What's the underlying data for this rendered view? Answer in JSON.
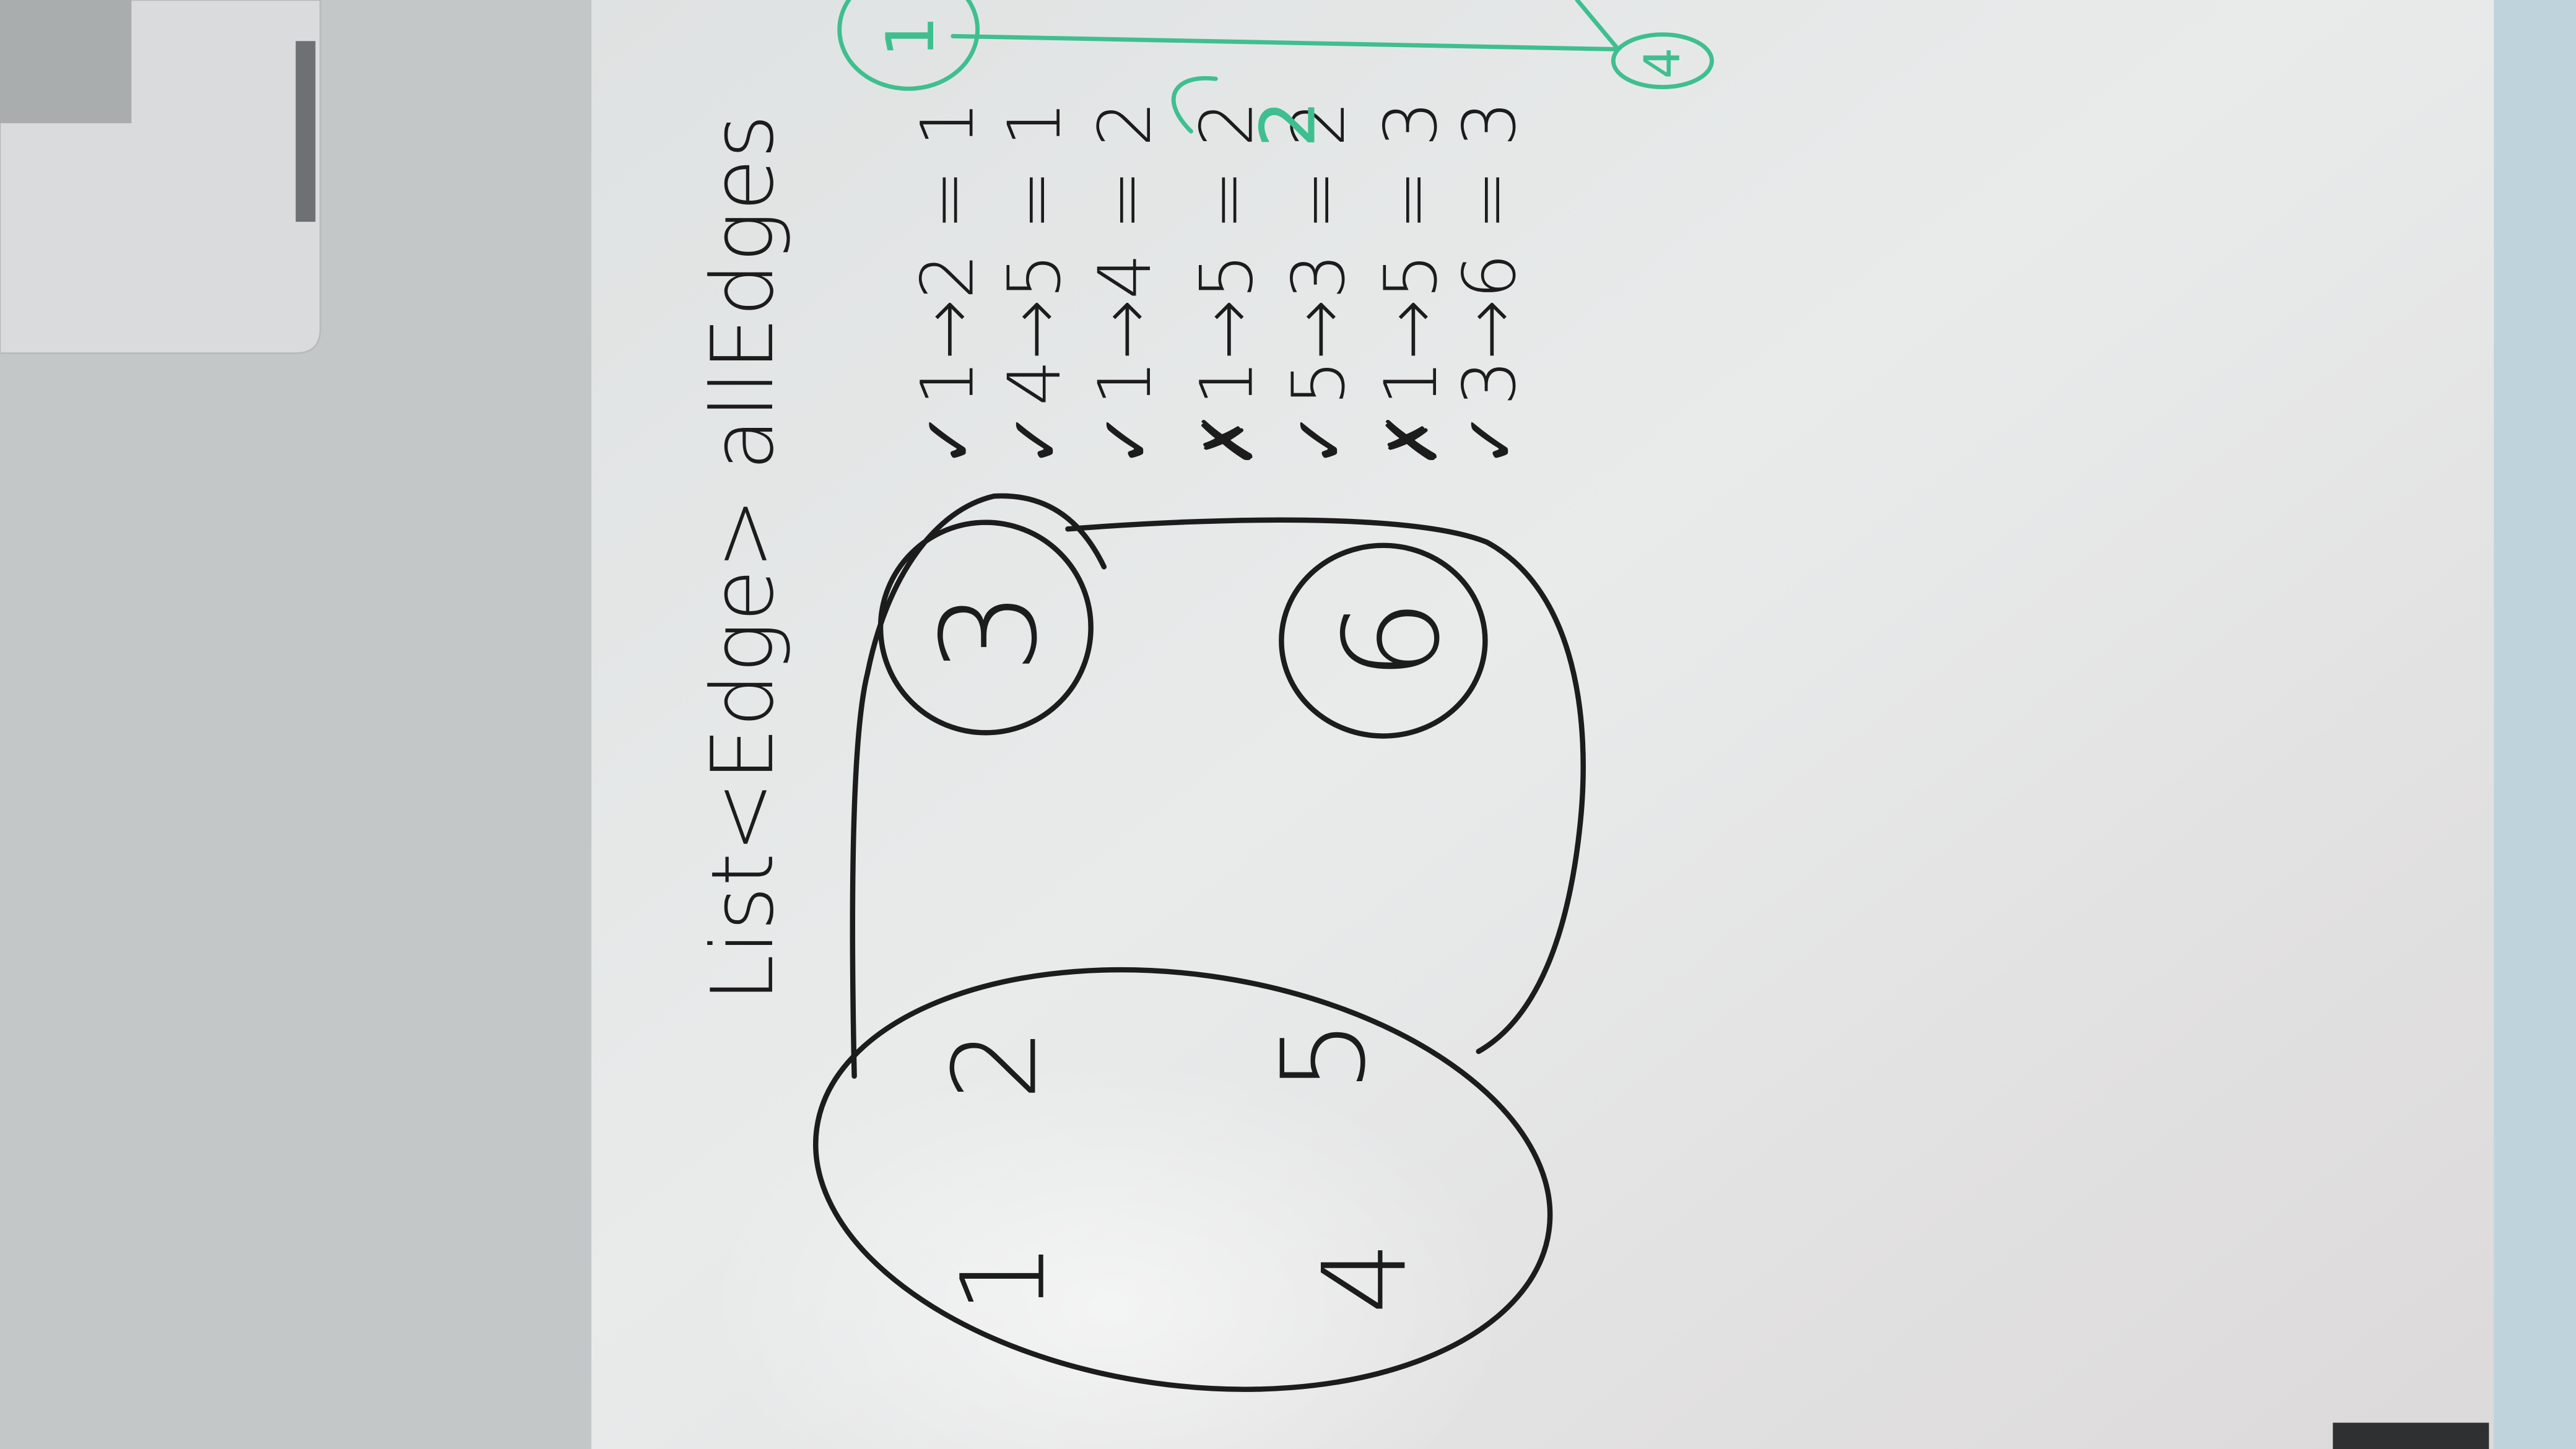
{
  "whiteboard": {
    "heading": "List<Edge> allEdges",
    "group_nodes": [
      "1",
      "2",
      "4",
      "5"
    ],
    "separate_nodes": [
      "3",
      "6"
    ],
    "edges": [
      {
        "mark": "✓",
        "text": "1→2 = 1"
      },
      {
        "mark": "✓",
        "text": "4→5 = 1"
      },
      {
        "mark": "✓",
        "text": "1→4 = 2"
      },
      {
        "mark": "✗",
        "text": "1→5 = 2"
      },
      {
        "mark": "✓",
        "text": "5→3 = 2"
      },
      {
        "mark": "✗",
        "text": "1→5 = 3"
      },
      {
        "mark": "✓",
        "text": "3→6 = 3"
      }
    ],
    "green_sketch": {
      "node_a": "1",
      "node_b": "4",
      "weight": "2"
    }
  },
  "colors": {
    "ink": "#1c1c1c",
    "green_marker": "#3fbf8f",
    "board": "#e4e6e6",
    "wall": "#c9cccd"
  }
}
